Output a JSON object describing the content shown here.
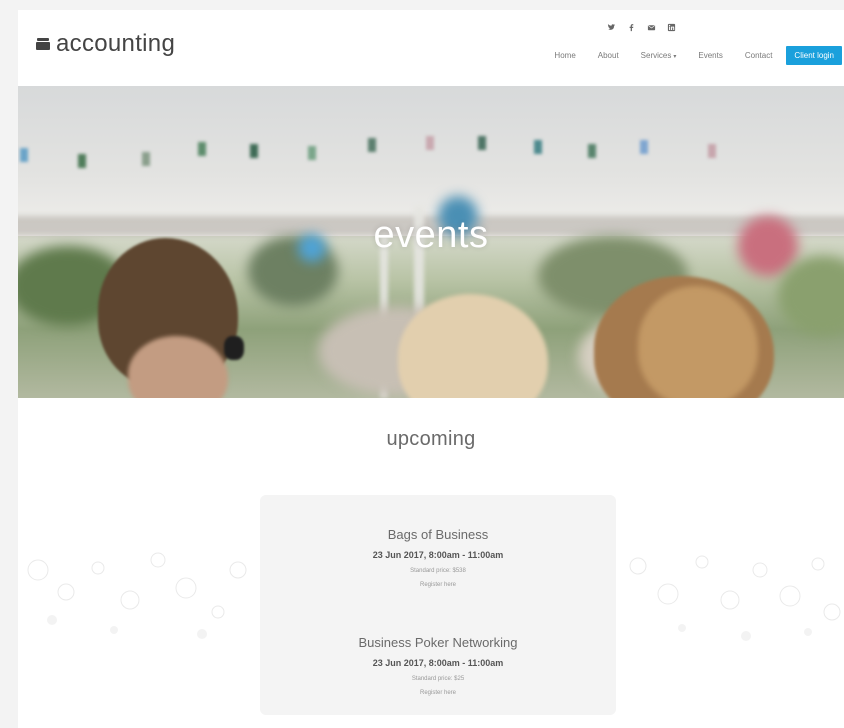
{
  "logo": {
    "text": "accounting",
    "icon": "briefcase-icon"
  },
  "social": [
    "twitter-icon",
    "facebook-icon",
    "email-icon",
    "linkedin-icon"
  ],
  "nav": {
    "items": [
      "Home",
      "About",
      "Services",
      "Events",
      "Contact"
    ],
    "services_caret": "▾",
    "client_login": "Client login"
  },
  "hero": {
    "title": "events"
  },
  "section": {
    "title": "upcoming"
  },
  "events": [
    {
      "name": "Bags of Business",
      "date": "23 Jun 2017, 8:00am - 11:00am",
      "price": "Standard price: $538",
      "register": "Register here"
    },
    {
      "name": "Business Poker Networking",
      "date": "23 Jun 2017, 8:00am - 11:00am",
      "price": "Standard price: $25",
      "register": "Register here"
    }
  ],
  "colors": {
    "accent": "#1aa0dc",
    "page_bg": "#ffffff",
    "card_bg": "#f4f4f4"
  }
}
